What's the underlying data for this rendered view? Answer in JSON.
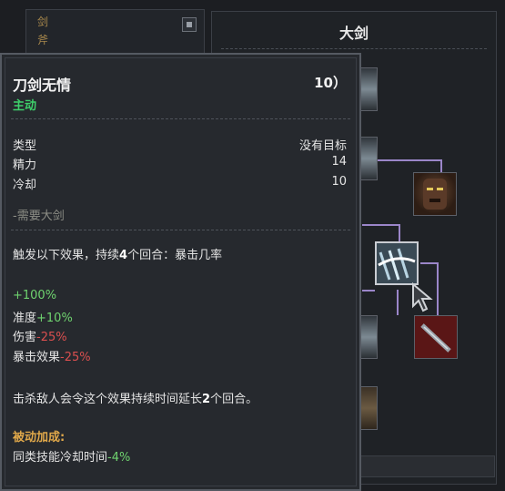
{
  "left_panel": {
    "categories": [
      "剑",
      "斧"
    ]
  },
  "right_panel": {
    "title": "大剑"
  },
  "tooltip": {
    "skill_name": "刀剑无情",
    "corner_text": "10）",
    "skill_type": "主动",
    "stats": [
      {
        "label": "类型",
        "value": "没有目标"
      },
      {
        "label": "精力",
        "value": "14"
      },
      {
        "label": "冷却",
        "value": "10"
      }
    ],
    "requirement": "-需要大剑",
    "desc": {
      "a": "触发以下效果，持续",
      "n": "4",
      "b": "个回合：暴击几率"
    },
    "effects": [
      {
        "label": "",
        "value": "+100%",
        "color": "#6fd36f"
      },
      {
        "label": "准度",
        "value": "+10%",
        "color": "#6fd36f"
      },
      {
        "label": "伤害",
        "value": "-25%",
        "color": "#d94f4f"
      },
      {
        "label": "暴击效果",
        "value": "-25%",
        "color": "#d94f4f"
      }
    ],
    "kill_note": {
      "a": "击杀敌人会令这个效果持续时间延长",
      "n": "2",
      "b": "个回合。"
    },
    "passive_title": "被动加成:",
    "passive": {
      "label": "同类技能冷却时间",
      "value": "-4%"
    }
  },
  "colors": {
    "active": "#3ecf6a",
    "positive": "#6fd36f",
    "negative": "#d94f4f",
    "passive_title": "#e0a84a",
    "tree_line": "#9b86c9"
  }
}
